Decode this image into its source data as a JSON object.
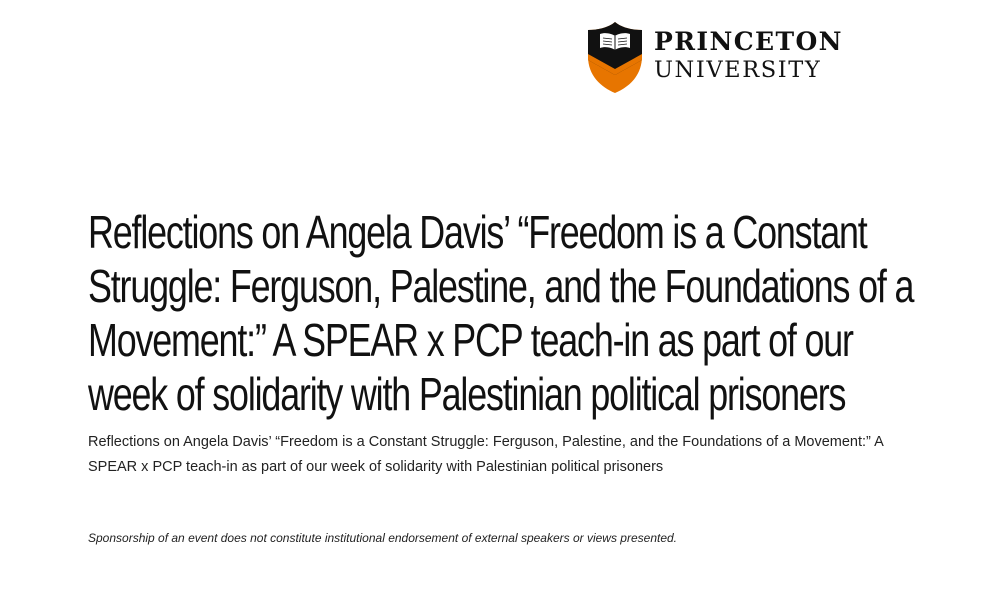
{
  "header": {
    "logo_line1": "PRINCETON",
    "logo_line2": "UNIVERSITY",
    "shield_icon": "princeton-shield-icon"
  },
  "event": {
    "title": "Reflections on Angela Davis’ “Freedom is a Constant Struggle: Ferguson, Palestine, and the Foundations of a Movement:” A SPEAR x PCP teach-in as part of our week of solidarity with Palestinian political prisoners",
    "subtitle": "Reflections on Angela Davis’ “Freedom is a Constant Struggle: Ferguson, Palestine, and the Foundations of a Movement:” A SPEAR x PCP teach-in as part of our week of solidarity with Palestinian political prisoners",
    "disclaimer": "Sponsorship of an event does not constitute institutional endorsement of external speakers or views presented."
  },
  "colors": {
    "brand_orange": "#E77500",
    "brand_black": "#111111",
    "background": "#FFFFFF"
  }
}
